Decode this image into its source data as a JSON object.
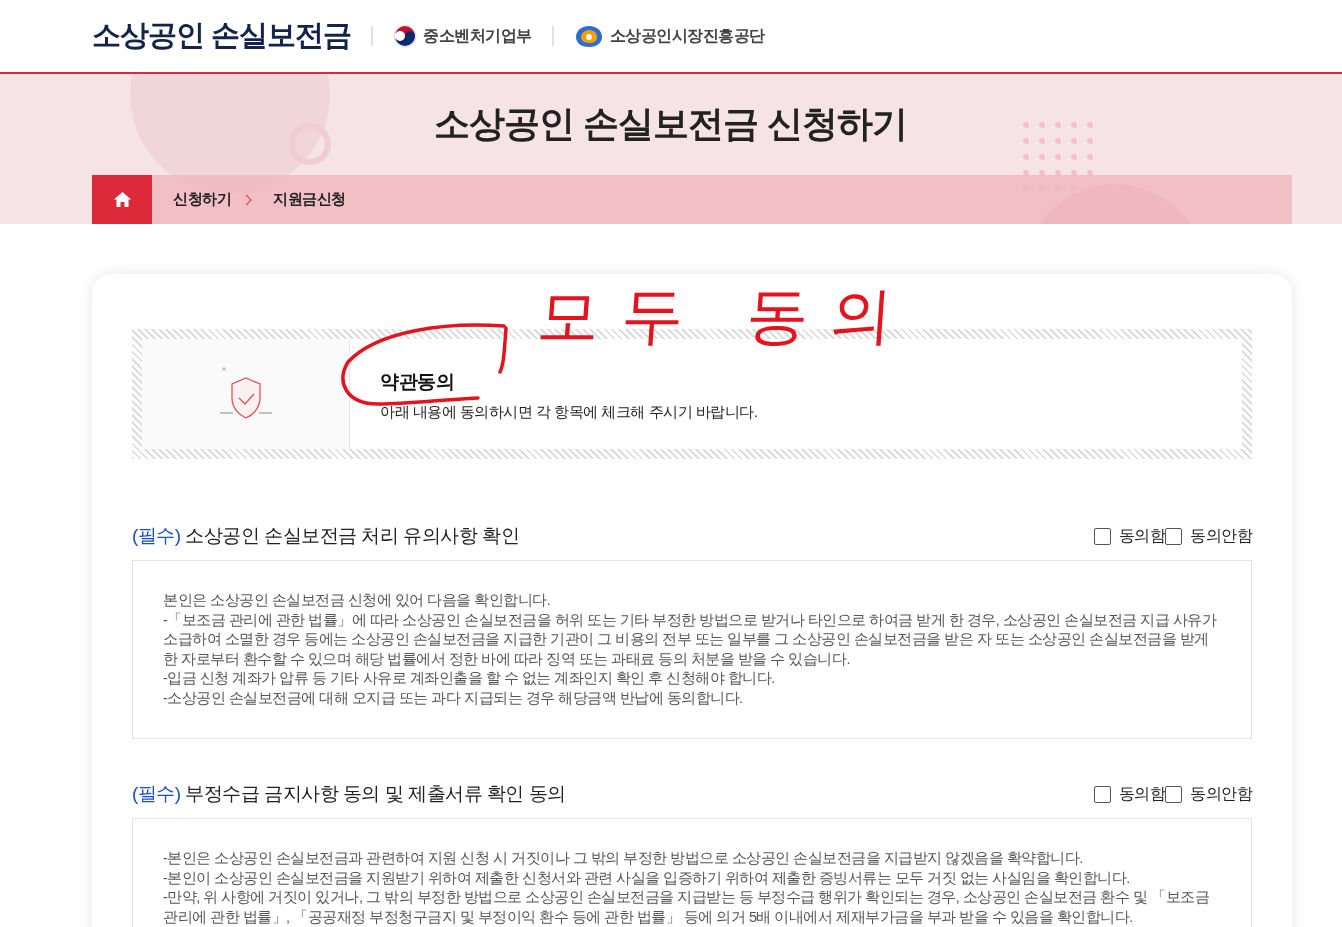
{
  "header": {
    "site_title": "소상공인 손실보전금",
    "partners": [
      {
        "name": "중소벤처기업부"
      },
      {
        "name": "소상공인시장진흥공단"
      }
    ]
  },
  "banner": {
    "title": "소상공인 손실보전금 신청하기",
    "breadcrumb": [
      "신청하기",
      "지원금신청"
    ]
  },
  "intro": {
    "title": "약관동의",
    "text": "아래 내용에 동의하시면 각 항목에 체크해 주시기 바랍니다."
  },
  "annotation": {
    "text": "모두 동의"
  },
  "sections": [
    {
      "tag": "(필수)",
      "title": "소상공인 손실보전금 처리 유의사항 확인",
      "options": [
        {
          "label": "동의함",
          "checked": false
        },
        {
          "label": "동의안함",
          "checked": false
        }
      ],
      "lines": [
        "본인은 소상공인 손실보전금 신청에 있어 다음을 확인합니다.",
        "-「보조금 관리에 관한 법률」에 따라 소상공인 손실보전금을 허위 또는 기타 부정한 방법으로 받거나 타인으로 하여금 받게 한 경우, 소상공인 손실보전금 지급 사유가 소급하여 소멸한 경우 등에는 소상공인 손실보전금을 지급한 기관이 그 비용의 전부 또는 일부를 그 소상공인 손실보전금을 받은 자 또는 소상공인 손실보전금을 받게 한 자로부터 환수할 수 있으며 해당 법률에서 정한 바에 따라 징역 또는 과태료 등의 처분을 받을 수 있습니다.",
        "-입금 신청 계좌가 압류 등 기타 사유로 계좌인출을 할 수 없는 계좌인지 확인 후 신청해야 합니다.",
        "-소상공인 손실보전금에 대해 오지급 또는 과다 지급되는 경우 해당금액 반납에 동의합니다."
      ]
    },
    {
      "tag": "(필수)",
      "title": "부정수급 금지사항 동의 및 제출서류 확인 동의",
      "options": [
        {
          "label": "동의함",
          "checked": false
        },
        {
          "label": "동의안함",
          "checked": false
        }
      ],
      "lines": [
        "-본인은 소상공인 손실보전금과 관련하여 지원 신청 시 거짓이나 그 밖의 부정한 방법으로 소상공인 손실보전금을 지급받지 않겠음을 확약합니다.",
        "-본인이 소상공인 손실보전금을 지원받기 위하여 제출한 신청서와 관련 사실을 입증하기 위하여 제출한 증빙서류는 모두 거짓 없는 사실임을 확인합니다.",
        "-만약, 위 사항에 거짓이 있거나, 그 밖의 부정한 방법으로 소상공인 손실보전금을 지급받는 등 부정수급 행위가 확인되는 경우, 소상공인 손실보전금 환수 및 「보조금 관리에 관한 법률」, 「공공재정 부정청구금지 및 부정이익 환수 등에 관한 법률」 등에 의거 5배 이내에서 제재부가금을 부과 받을 수 있음을 확인합니다."
      ]
    }
  ]
}
